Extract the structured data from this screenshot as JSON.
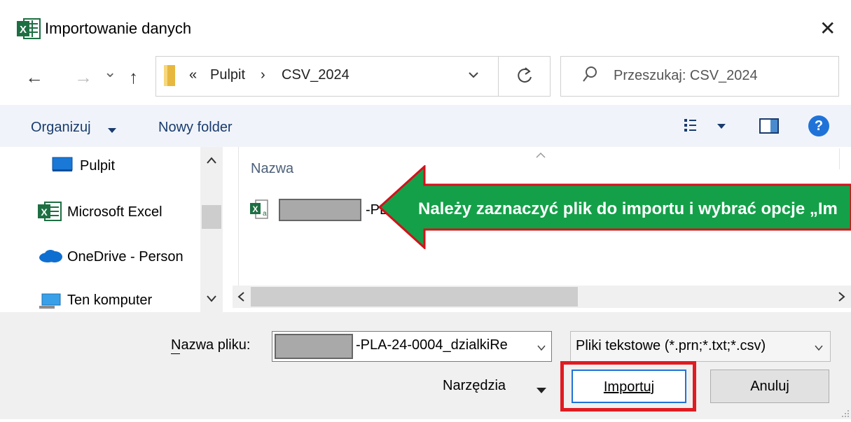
{
  "window": {
    "app_icon": "excel-icon",
    "title": "Importowanie danych",
    "close_glyph": "✕"
  },
  "nav": {
    "back": "←",
    "forward": "→",
    "recent": "⌄",
    "up": "↑"
  },
  "address": {
    "chevrons": "«",
    "segments": [
      "Pulpit",
      "CSV_2024"
    ],
    "separator": "›"
  },
  "search": {
    "placeholder": "Przeszukaj: CSV_2024"
  },
  "toolbar": {
    "organize": "Organizuj",
    "new_folder": "Nowy folder",
    "help": "?"
  },
  "sidebar": {
    "items": [
      {
        "label": "Pulpit",
        "icon": "desktop-icon"
      },
      {
        "label": "Microsoft Excel",
        "icon": "excel-icon"
      },
      {
        "label": "OneDrive - Person",
        "icon": "onedrive-icon"
      },
      {
        "label": "Ten komputer",
        "icon": "computer-icon"
      }
    ]
  },
  "files": {
    "column_header": "Nazwa",
    "items": [
      {
        "name_suffix": "-PL",
        "icon": "csv-file-icon"
      }
    ]
  },
  "annotation": {
    "text": "Należy zaznaczyć plik do importu i wybrać opcje „Im",
    "color": "#14a049",
    "border": "#d4111a"
  },
  "bottom": {
    "filename_label": "Nazwa pliku:",
    "filename_value": "-PLA-24-0004_dzialkiRe",
    "filetype_value": "Pliki tekstowe (*.prn;*.txt;*.csv)",
    "tools_label": "Narzędzia",
    "import_label": "Importuj",
    "cancel_label": "Anuluj"
  },
  "colors": {
    "highlight_box": "#e11b22",
    "link_blue": "#1a3b6d"
  }
}
